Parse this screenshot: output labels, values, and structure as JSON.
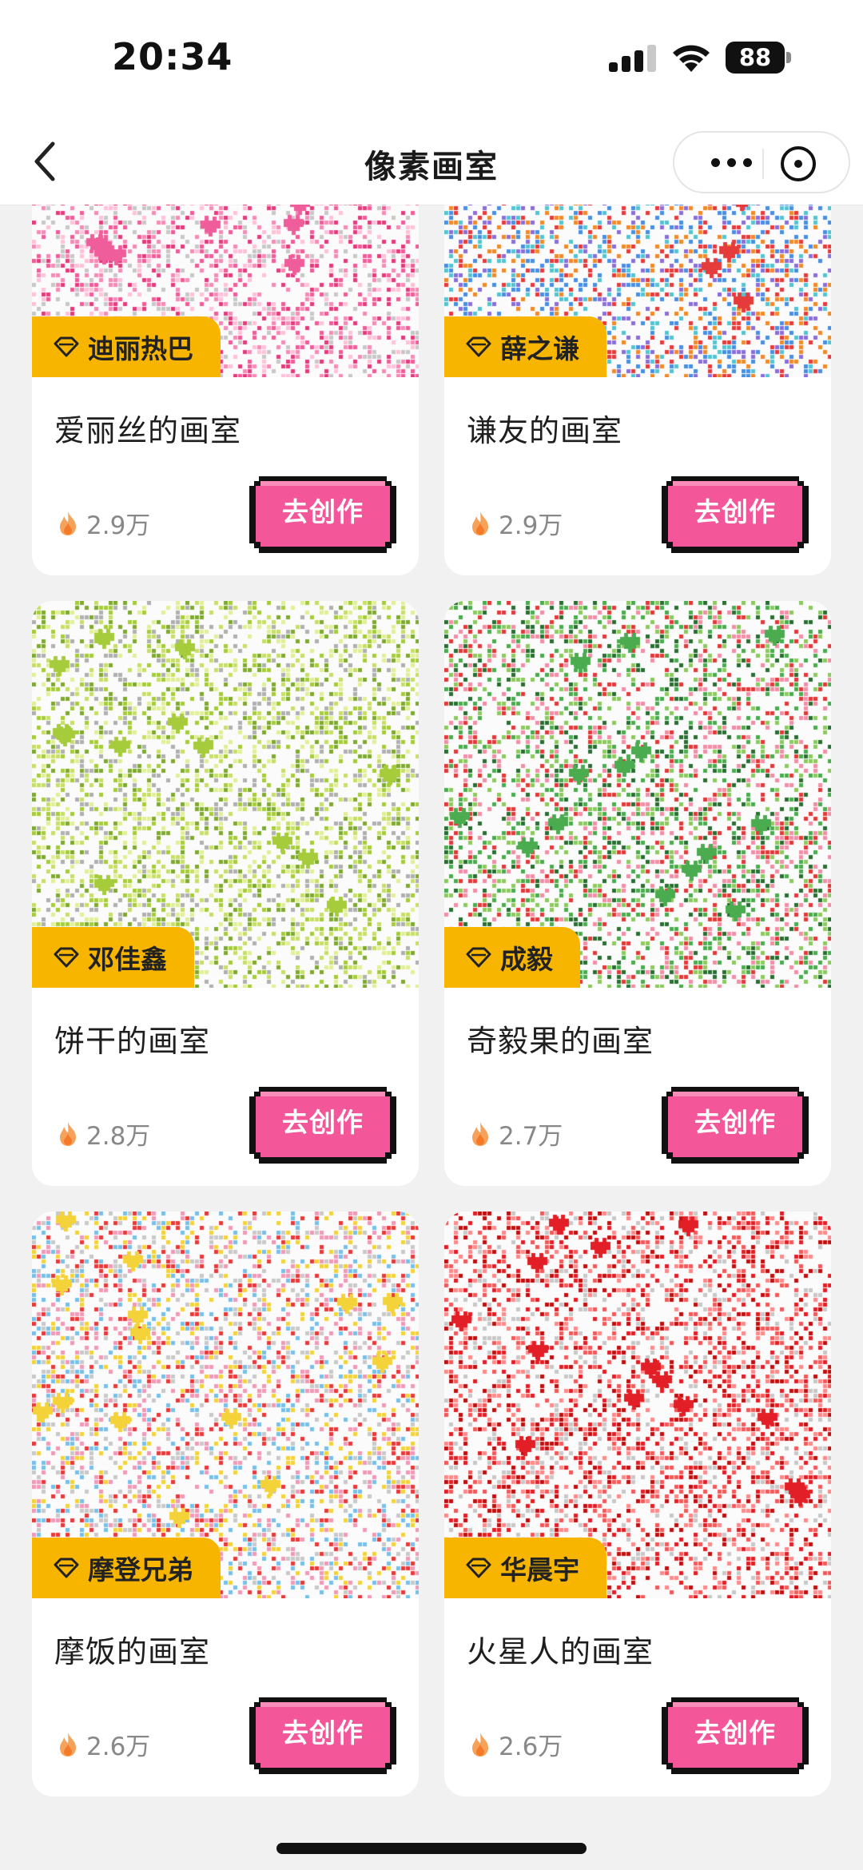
{
  "status_bar": {
    "time": "20:34",
    "battery": "88"
  },
  "nav": {
    "title": "像素画室"
  },
  "cards": [
    {
      "owner": "迪丽热巴",
      "name": "爱丽丝的画室",
      "heat": "2.9万",
      "button": "去创作",
      "palette": [
        "#ef5d9a",
        "#f48cb5",
        "#ffc2d9",
        "#e23c7d",
        "#c8c8c8"
      ]
    },
    {
      "owner": "薛之谦",
      "name": "谦友的画室",
      "heat": "2.9万",
      "button": "去创作",
      "palette": [
        "#e63b3b",
        "#4a8fe0",
        "#55c4d0",
        "#8b6fd6",
        "#f08a2a"
      ]
    },
    {
      "owner": "邓佳鑫",
      "name": "饼干的画室",
      "heat": "2.8万",
      "button": "去创作",
      "palette": [
        "#a6cc3b",
        "#c7de6a",
        "#7ea932",
        "#e1ee9a",
        "#b0b0b0"
      ]
    },
    {
      "owner": "成毅",
      "name": "奇毅果的画室",
      "heat": "2.7万",
      "button": "去创作",
      "palette": [
        "#4bab4f",
        "#8cc960",
        "#e23a3a",
        "#2b6e34",
        "#f08fa6"
      ]
    },
    {
      "owner": "摩登兄弟",
      "name": "摩饭的画室",
      "heat": "2.6万",
      "button": "去创作",
      "palette": [
        "#f3d23a",
        "#f09ab8",
        "#e83a3a",
        "#79c0e8",
        "#c9c9c9"
      ]
    },
    {
      "owner": "华晨宇",
      "name": "火星人的画室",
      "heat": "2.6万",
      "button": "去创作",
      "palette": [
        "#e21f26",
        "#f25a5a",
        "#c01010",
        "#ff8a8a",
        "#c8c8c8"
      ]
    }
  ]
}
